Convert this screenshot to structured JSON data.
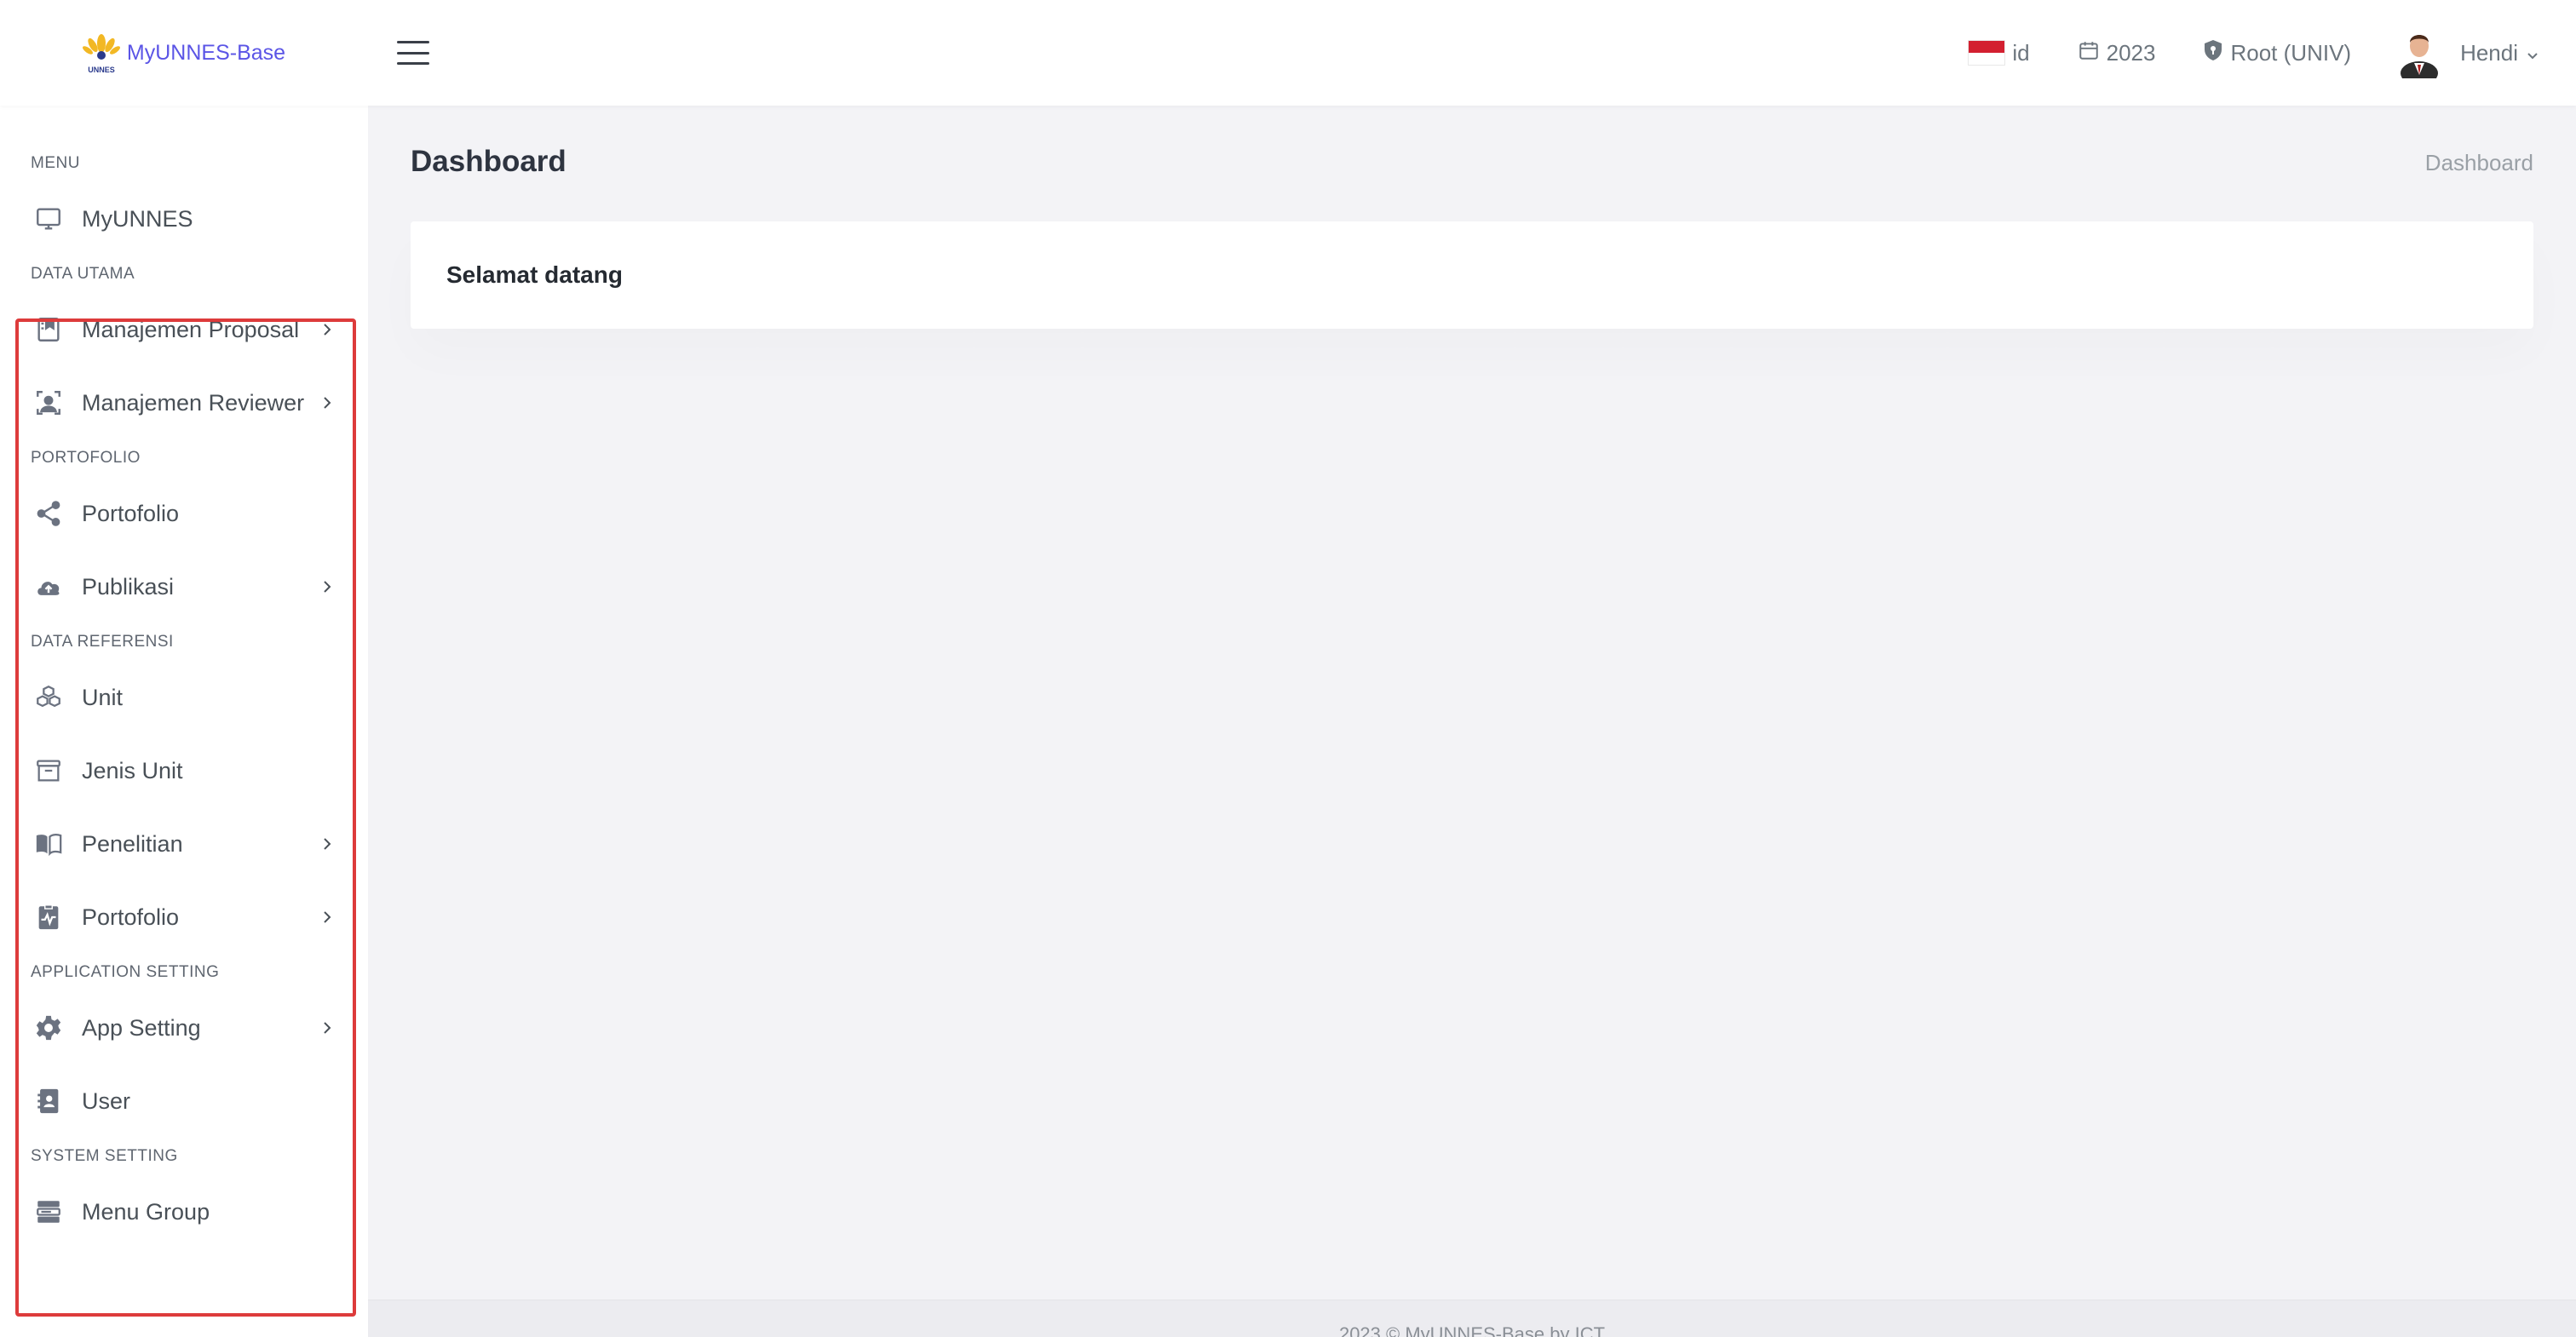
{
  "header": {
    "app_name": "MyUNNES-Base",
    "logo_caption": "UNNES",
    "language": "id",
    "year": "2023",
    "role": "Root (UNIV)",
    "user_name": "Hendi"
  },
  "sidebar": {
    "sections": [
      {
        "title": "MENU",
        "items": [
          {
            "label": "MyUNNES",
            "icon": "monitor-icon",
            "has_submenu": false
          }
        ]
      },
      {
        "title": "DATA UTAMA",
        "items": [
          {
            "label": "Manajemen Proposal",
            "icon": "bookmark-book-icon",
            "has_submenu": true
          },
          {
            "label": "Manajemen Reviewer",
            "icon": "user-frame-icon",
            "has_submenu": true
          }
        ]
      },
      {
        "title": "PORTOFOLIO",
        "items": [
          {
            "label": "Portofolio",
            "icon": "share-icon",
            "has_submenu": false
          },
          {
            "label": "Publikasi",
            "icon": "cloud-upload-icon",
            "has_submenu": true
          }
        ]
      },
      {
        "title": "DATA REFERENSI",
        "items": [
          {
            "label": "Unit",
            "icon": "cubes-icon",
            "has_submenu": false
          },
          {
            "label": "Jenis Unit",
            "icon": "archive-icon",
            "has_submenu": false
          },
          {
            "label": "Penelitian",
            "icon": "book-open-icon",
            "has_submenu": true
          },
          {
            "label": "Portofolio",
            "icon": "clipboard-pulse-icon",
            "has_submenu": true
          }
        ]
      },
      {
        "title": "APPLICATION SETTING",
        "items": [
          {
            "label": "App Setting",
            "icon": "gear-icon",
            "has_submenu": true
          },
          {
            "label": "User",
            "icon": "contact-book-icon",
            "has_submenu": false
          }
        ]
      },
      {
        "title": "SYSTEM SETTING",
        "items": [
          {
            "label": "Menu Group",
            "icon": "server-icon",
            "has_submenu": false
          }
        ]
      }
    ],
    "highlight_color": "#dd3b3b"
  },
  "main": {
    "page_title": "Dashboard",
    "breadcrumb": "Dashboard",
    "welcome_text": "Selamat datang"
  },
  "footer": {
    "text": "2023 © MyUNNES-Base by ICT"
  },
  "colors": {
    "brand": "#5b55e6",
    "background": "#f3f3f6",
    "highlight": "#dd3b3b"
  }
}
